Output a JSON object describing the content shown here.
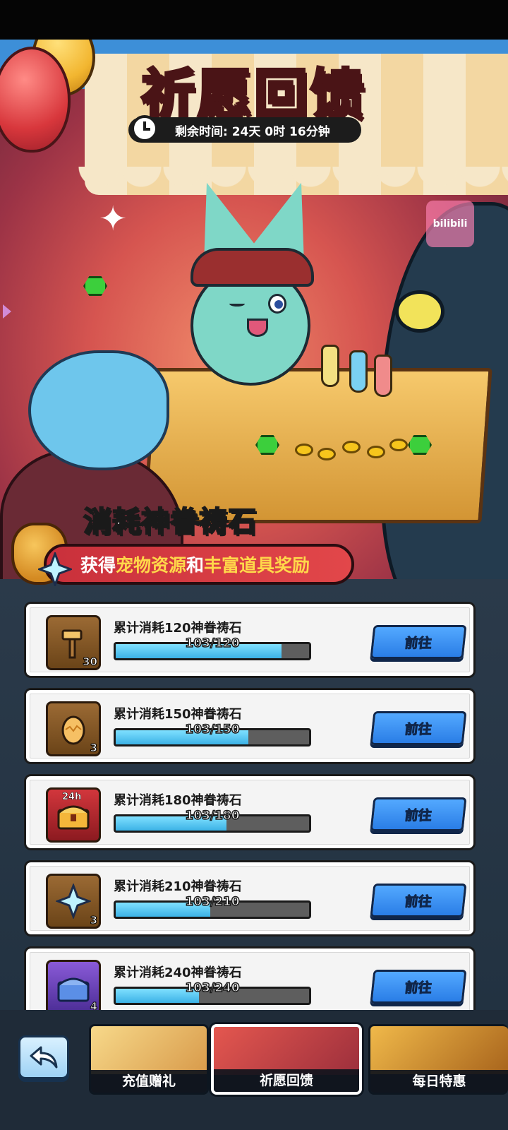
{
  "header": {
    "title": "祈愿回馈",
    "timer_text": "剩余时间: 24天 0时 16分钟",
    "watermark": "bilibili"
  },
  "promo": {
    "title": "消耗神眷祷石",
    "subtitle_prefix": "获得",
    "subtitle_highlight_1": "宠物资源",
    "subtitle_mid": "和",
    "subtitle_highlight_2": "丰富道具奖励"
  },
  "tasks": [
    {
      "label": "累计消耗120神眷祷石",
      "progress_text": "103/120",
      "progress": 0.858,
      "reward_icon": "hammer-icon",
      "reward_count": "30",
      "reward_bg": "brown",
      "button": "前往"
    },
    {
      "label": "累计消耗150神眷祷石",
      "progress_text": "103/150",
      "progress": 0.687,
      "reward_icon": "egg-icon",
      "reward_count": "3",
      "reward_bg": "brown",
      "button": "前往"
    },
    {
      "label": "累计消耗180神眷祷石",
      "progress_text": "103/180",
      "progress": 0.572,
      "reward_icon": "treasure-chest-icon",
      "reward_count": "",
      "reward_tag": "24h",
      "reward_bg": "red",
      "button": "前往"
    },
    {
      "label": "累计消耗210神眷祷石",
      "progress_text": "103/210",
      "progress": 0.49,
      "reward_icon": "star-crystal-icon",
      "reward_count": "3",
      "reward_bg": "brown",
      "button": "前往"
    },
    {
      "label": "累计消耗240神眷祷石",
      "progress_text": "103/240",
      "progress": 0.429,
      "reward_icon": "blue-chest-icon",
      "reward_count": "4",
      "reward_bg": "purple",
      "button": "前往"
    }
  ],
  "bottom_nav": {
    "tabs": [
      {
        "label": "充值赠礼",
        "active": false
      },
      {
        "label": "祈愿回馈",
        "active": true
      },
      {
        "label": "每日特惠",
        "active": false
      }
    ]
  },
  "colors": {
    "title": "#ff6b6b",
    "progress_fill": "#3cb2e6",
    "button": "#2a7de6",
    "highlight": "#ffd84a"
  }
}
